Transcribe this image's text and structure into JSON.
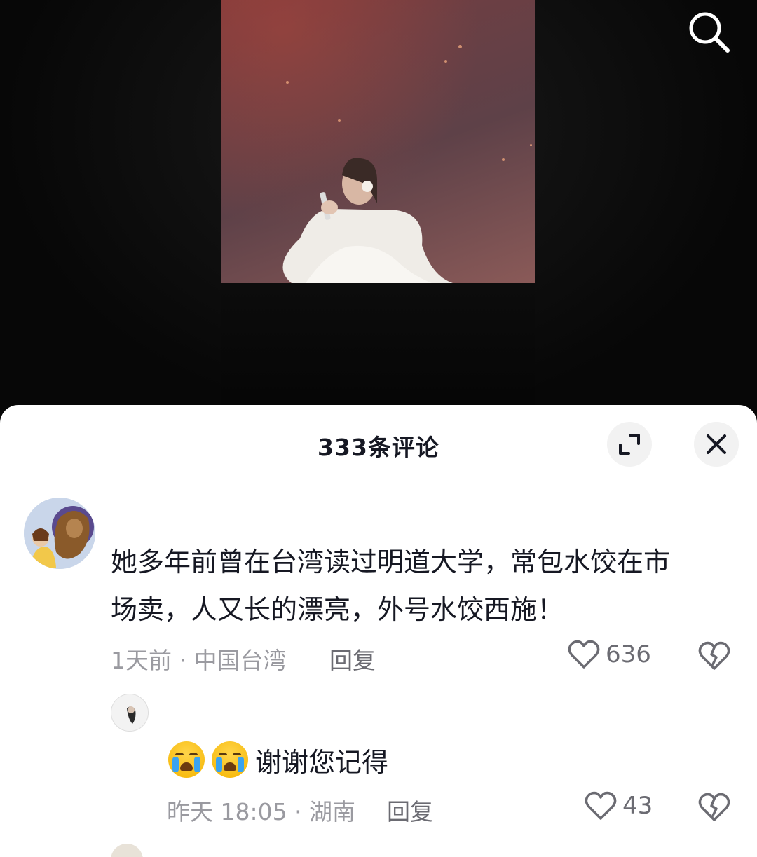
{
  "video": {
    "search_icon": "search-icon"
  },
  "comments_panel": {
    "title": "333条评论",
    "expand_icon": "expand-icon",
    "close_icon": "close-icon"
  },
  "comments": [
    {
      "text_line1": "她多年前曾在台湾读过明道大学，常包水饺在市",
      "text_line2": "场卖，人又长的漂亮，外号水饺西施！",
      "meta": "1天前 · 中国台湾",
      "reply_label": "回复",
      "likes": "636"
    }
  ],
  "reply": {
    "emojis": [
      "loudly-crying-emoji",
      "loudly-crying-emoji"
    ],
    "text": "谢谢您记得",
    "meta": "昨天 18:05 · 湖南",
    "reply_label": "回复",
    "likes": "43"
  },
  "colors": {
    "sheet_bg": "#ffffff",
    "text_primary": "#161823",
    "text_secondary": "#9a9aa0"
  }
}
